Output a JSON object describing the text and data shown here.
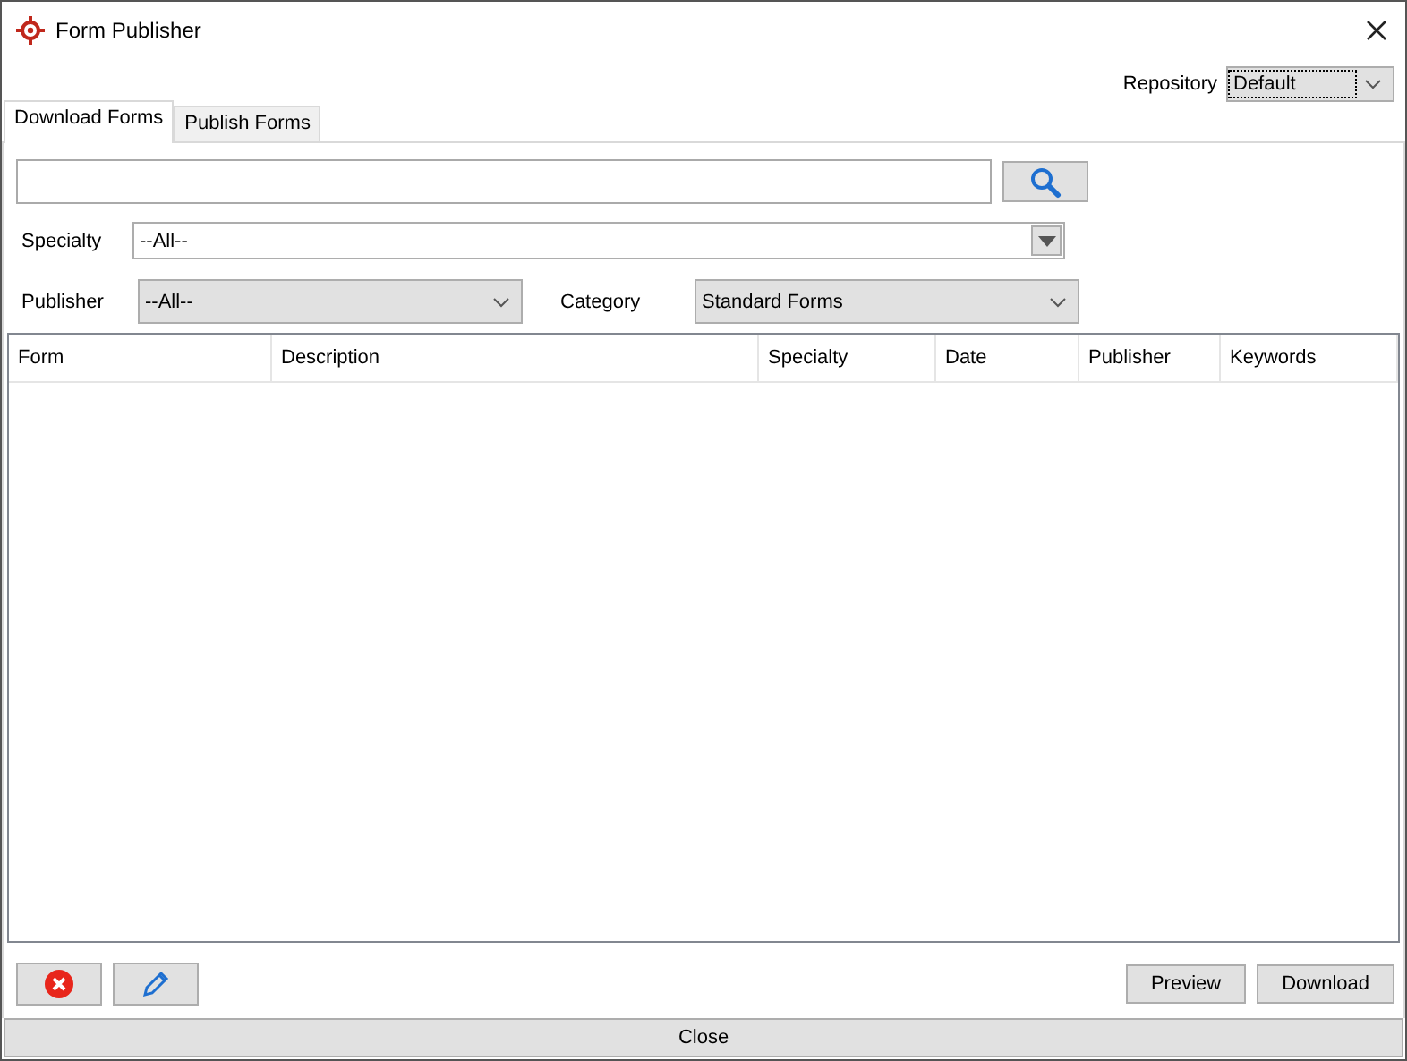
{
  "window": {
    "title": "Form Publisher"
  },
  "repository": {
    "label": "Repository",
    "value": "Default"
  },
  "tabs": [
    {
      "label": "Download Forms",
      "selected": true
    },
    {
      "label": "Publish Forms",
      "selected": false
    }
  ],
  "specialty": {
    "label": "Specialty",
    "value": "--All--"
  },
  "publisher": {
    "label": "Publisher",
    "value": "--All--"
  },
  "category": {
    "label": "Category",
    "value": "Standard Forms"
  },
  "table": {
    "columns": [
      "Form",
      "Description",
      "Specialty",
      "Date",
      "Publisher",
      "Keywords"
    ]
  },
  "buttons": [
    "Preview",
    "Download"
  ],
  "close_button": "Close"
}
